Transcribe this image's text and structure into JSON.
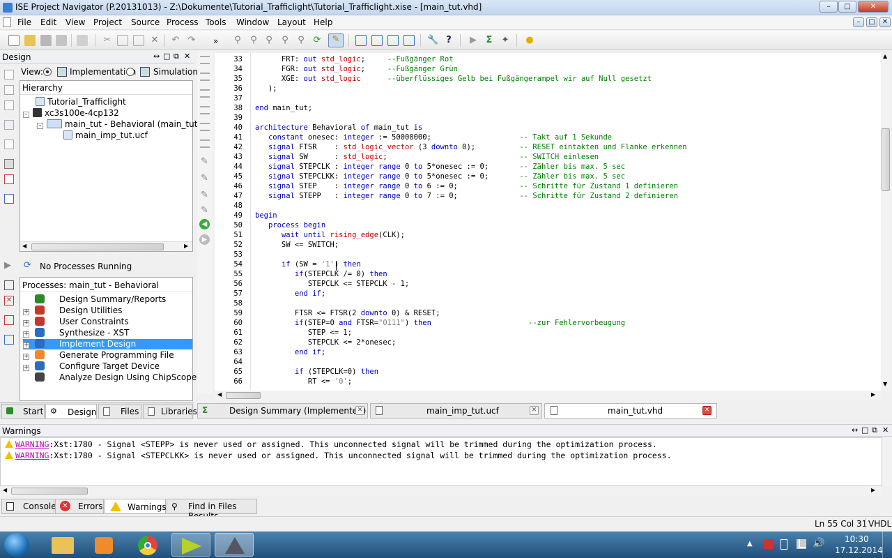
{
  "window": {
    "title": "ISE Project Navigator (P.20131013) - Z:\\Dokumente\\Tutorial_Trafficlight\\Tutorial_Trafficlight.xise - [main_tut.vhd]"
  },
  "menu": [
    "File",
    "Edit",
    "View",
    "Project",
    "Source",
    "Process",
    "Tools",
    "Window",
    "Layout",
    "Help"
  ],
  "design_panel": {
    "title": "Design",
    "view_label": "View:",
    "view_impl": "Implementation",
    "view_sim": "Simulation",
    "hierarchy_label": "Hierarchy",
    "tree": [
      "Tutorial_Trafficlight",
      "xc3s100e-4cp132",
      "main_tut - Behavioral (main_tut",
      "main_imp_tut.ucf"
    ]
  },
  "processes": {
    "status": "No Processes Running",
    "header": "Processes: main_tut - Behavioral",
    "items": [
      "Design Summary/Reports",
      "Design Utilities",
      "User Constraints",
      "Synthesize - XST",
      "Implement Design",
      "Generate Programming File",
      "Configure Target Device",
      "Analyze Design Using ChipScope"
    ],
    "selected_index": 4
  },
  "left_tabs": [
    "Start",
    "Design",
    "Files",
    "Libraries"
  ],
  "editor": {
    "lines": [
      {
        "n": "33",
        "t": "      FRT: out std_logic;     --Fußgänger Rot"
      },
      {
        "n": "34",
        "t": "      FGR: out std_logic;     --Fußgänger Grün"
      },
      {
        "n": "35",
        "t": "      XGE: out std_logic      --überflüssiges Gelb bei Fußgängerampel wir auf Null gesetzt"
      },
      {
        "n": "36",
        "t": "   );"
      },
      {
        "n": "37",
        "t": ""
      },
      {
        "n": "38",
        "t": "end main_tut;"
      },
      {
        "n": "39",
        "t": ""
      },
      {
        "n": "40",
        "t": "architecture Behavioral of main_tut is"
      },
      {
        "n": "41",
        "t": "   constant onesec: integer := 50000000;                    -- Takt auf 1 Sekunde"
      },
      {
        "n": "42",
        "t": "   signal FTSR    : std_logic_vector (3 downto 0);          -- RESET eintakten und Flanke erkennen"
      },
      {
        "n": "43",
        "t": "   signal SW      : std_logic;                              -- SWITCH einlesen"
      },
      {
        "n": "44",
        "t": "   signal STEPCLK : integer range 0 to 5*onesec := 0;       -- Zähler bis max. 5 sec"
      },
      {
        "n": "45",
        "t": "   signal STEPCLKK: integer range 0 to 5*onesec := 0;       -- Zähler bis max. 5 sec"
      },
      {
        "n": "46",
        "t": "   signal STEP    : integer range 0 to 6 := 0;              -- Schritte für Zustand 1 definieren"
      },
      {
        "n": "47",
        "t": "   signal STEPP   : integer range 0 to 7 := 0;              -- Schritte für Zustand 2 definieren"
      },
      {
        "n": "48",
        "t": ""
      },
      {
        "n": "49",
        "t": "begin"
      },
      {
        "n": "50",
        "t": "   process begin"
      },
      {
        "n": "51",
        "t": "      wait until rising_edge(CLK);"
      },
      {
        "n": "52",
        "t": "      SW <= SWITCH;"
      },
      {
        "n": "53",
        "t": ""
      },
      {
        "n": "54",
        "t": "      if (SW = '1') then"
      },
      {
        "n": "55",
        "t": "         if(STEPCLK /= 0) then"
      },
      {
        "n": "56",
        "t": "            STEPCLK <= STEPCLK - 1;"
      },
      {
        "n": "57",
        "t": "         end if;"
      },
      {
        "n": "58",
        "t": ""
      },
      {
        "n": "59",
        "t": "         FTSR <= FTSR(2 downto 0) & RESET;"
      },
      {
        "n": "60",
        "t": "         if(STEP=0 and FTSR=\"0111\") then                      --zur Fehlervorbeugung"
      },
      {
        "n": "61",
        "t": "            STEP <= 1;"
      },
      {
        "n": "62",
        "t": "            STEPCLK <= 2*onesec;"
      },
      {
        "n": "63",
        "t": "         end if;"
      },
      {
        "n": "64",
        "t": ""
      },
      {
        "n": "65",
        "t": "         if (STEPCLK=0) then"
      },
      {
        "n": "66",
        "t": "            RT <= '0';"
      }
    ]
  },
  "editor_tabs": [
    "Design Summary (Implemented)",
    "main_imp_tut.ucf",
    "main_tut.vhd"
  ],
  "warnings_panel": {
    "title": "Warnings",
    "items": [
      {
        "tag": "WARNING",
        "msg": ":Xst:1780 - Signal <STEPP> is never used or assigned. This unconnected signal will be trimmed during the optimization process."
      },
      {
        "tag": "WARNING",
        "msg": ":Xst:1780 - Signal <STEPCLKK> is never used or assigned. This unconnected signal will be trimmed during the optimization process."
      }
    ]
  },
  "bottom_tabs": [
    "Console",
    "Errors",
    "Warnings",
    "Find in Files Results"
  ],
  "status": {
    "position": "Ln 55 Col 31",
    "language": "VHDL"
  },
  "clock": {
    "time": "10:30",
    "date": "17.12.2014"
  }
}
